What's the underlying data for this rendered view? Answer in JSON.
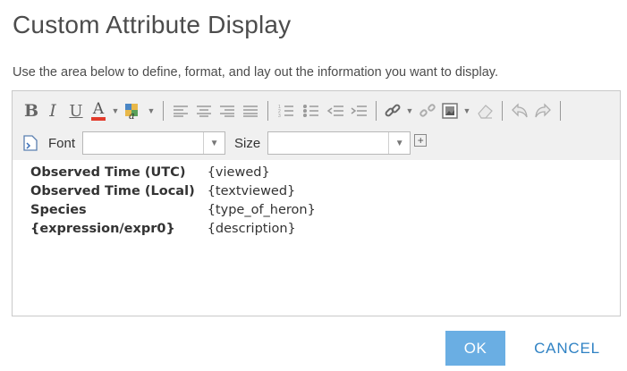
{
  "dialog": {
    "title": "Custom Attribute Display",
    "instructions": "Use the area below to define, format, and lay out the information you want to display."
  },
  "toolbar": {
    "row1_icons": [
      "bold-icon",
      "italic-icon",
      "underline-icon",
      "font-color-icon",
      "highlight-color-icon",
      "align-left-icon",
      "align-center-icon",
      "align-right-icon",
      "align-justify-icon",
      "numbered-list-icon",
      "bullet-list-icon",
      "outdent-icon",
      "indent-icon",
      "link-icon",
      "unlink-icon",
      "insert-image-icon",
      "remove-format-icon",
      "undo-icon",
      "redo-icon"
    ],
    "bold_label": "B",
    "italic_label": "I",
    "underline_label": "U",
    "font_color_label": "A",
    "font_color": "#e23b2b",
    "font_label": "Font",
    "font_value": "",
    "size_label": "Size",
    "size_value": "",
    "expand_label": "+"
  },
  "content": {
    "rows": [
      {
        "label": "Observed Time (UTC)",
        "value": "{viewed}"
      },
      {
        "label": "Observed Time (Local)",
        "value": "{textviewed}"
      },
      {
        "label": "Species",
        "value": "{type_of_heron}"
      },
      {
        "label": "{expression/expr0}",
        "value": "{description}"
      }
    ]
  },
  "buttons": {
    "ok": "OK",
    "cancel": "CANCEL",
    "ok_color": "#6aaee3",
    "cancel_color": "#2f82c4"
  }
}
